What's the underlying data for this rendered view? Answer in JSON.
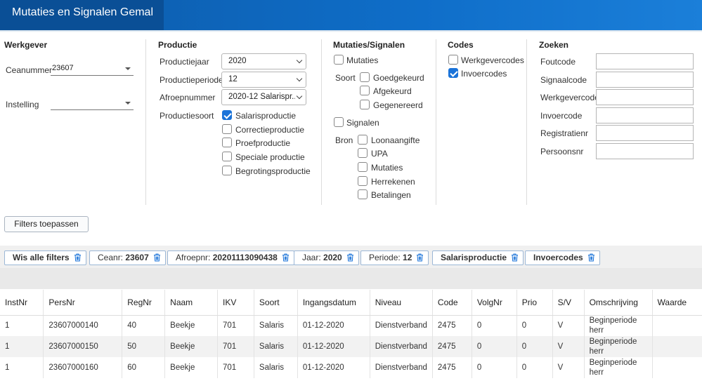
{
  "app": {
    "title": "Mutaties en Signalen Gemal"
  },
  "werkgever": {
    "heading": "Werkgever",
    "ceanummer_label": "Ceanummer",
    "ceanummer_value": "23607",
    "instelling_label": "Instelling",
    "instelling_value": ""
  },
  "productie": {
    "heading": "Productie",
    "jaar_label": "Productiejaar",
    "jaar_value": "2020",
    "periode_label": "Productieperiode",
    "periode_value": "12",
    "afroep_label": "Afroepnummer",
    "afroep_value": "2020-12 Salarispr...",
    "soort_label": "Productiesoort",
    "soorten": [
      {
        "label": "Salarisproductie",
        "checked": true
      },
      {
        "label": "Correctieproductie",
        "checked": false
      },
      {
        "label": "Proefproductie",
        "checked": false
      },
      {
        "label": "Speciale productie",
        "checked": false
      },
      {
        "label": "Begrotingsproductie",
        "checked": false
      }
    ]
  },
  "mutaties": {
    "heading": "Mutaties/Signalen",
    "mutaties_label": "Mutaties",
    "soort_label": "Soort",
    "soorten": [
      "Goedgekeurd",
      "Afgekeurd",
      "Gegenereerd"
    ],
    "signalen_label": "Signalen",
    "bron_label": "Bron",
    "bronnen": [
      "Loonaangifte",
      "UPA",
      "Mutaties",
      "Herrekenen",
      "Betalingen"
    ]
  },
  "codes": {
    "heading": "Codes",
    "werkgevercodes_label": "Werkgevercodes",
    "invoercodes_label": "Invoercodes"
  },
  "zoeken": {
    "heading": "Zoeken",
    "fields": [
      "Foutcode",
      "Signaalcode",
      "Werkgevercode",
      "Invoercode",
      "Registratienr",
      "Persoonsnr"
    ]
  },
  "actions": {
    "apply_filters": "Filters toepassen"
  },
  "chips": {
    "clear_all": "Wis alle filters",
    "ceanr_label": "Ceanr:",
    "ceanr_value": "23607",
    "afroepnr_label": "Afroepnr:",
    "afroepnr_value": "20201113090438",
    "jaar_label": "Jaar:",
    "jaar_value": "2020",
    "periode_label": "Periode:",
    "periode_value": "12",
    "salarisproductie": "Salarisproductie",
    "invoercodes": "Invoercodes"
  },
  "table": {
    "columns": [
      "InstNr",
      "PersNr",
      "RegNr",
      "Naam",
      "IKV",
      "Soort",
      "Ingangsdatum",
      "Niveau",
      "Code",
      "VolgNr",
      "Prio",
      "S/V",
      "Omschrijving",
      "Waarde"
    ],
    "rows": [
      [
        "1",
        "23607000140",
        "40",
        "Beekje",
        "701",
        "Salaris",
        "01-12-2020",
        "Dienstverband",
        "2475",
        "0",
        "0",
        "V",
        "Beginperiode herr",
        ""
      ],
      [
        "1",
        "23607000150",
        "50",
        "Beekje",
        "701",
        "Salaris",
        "01-12-2020",
        "Dienstverband",
        "2475",
        "0",
        "0",
        "V",
        "Beginperiode herr",
        ""
      ],
      [
        "1",
        "23607000160",
        "60",
        "Beekje",
        "701",
        "Salaris",
        "01-12-2020",
        "Dienstverband",
        "2475",
        "0",
        "0",
        "V",
        "Beginperiode herr",
        ""
      ]
    ]
  },
  "colors": {
    "header_blue": "#0f6ec9",
    "checkbox_blue": "#1a73d9",
    "trash_blue": "#1a73d9"
  }
}
